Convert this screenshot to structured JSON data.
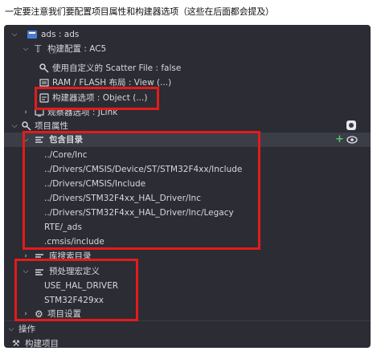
{
  "note": "一定要注意我们要配置项目属性和构建器选项（这些在后面都会提及）",
  "tree": {
    "root_label": "ads : ads",
    "build_config_label": "构建配置 : AC5",
    "clipped_row": "...",
    "scatter_label": "使用自定义的 Scatter File : false",
    "ramflash_label": "RAM / FLASH 布局 : View (...)",
    "builder_options_label": "构建器选项 : Object (...)",
    "observe_label": "观察器选项 : JLink",
    "project_props_label": "项目属性",
    "include_dirs_label": "包含目录",
    "include_dirs": [
      "../Core/Inc",
      "../Drivers/CMSIS/Device/ST/STM32F4xx/Include",
      "../Drivers/CMSIS/Include",
      "../Drivers/STM32F4xx_HAL_Driver/Inc",
      "../Drivers/STM32F4xx_HAL_Driver/Inc/Legacy",
      "RTE/_ads",
      ".cmsis/include"
    ],
    "lib_dirs_label": "库搜索目录",
    "defines_label": "预处理宏定义",
    "defines": [
      "USE_HAL_DRIVER",
      "STM32F429xx"
    ],
    "project_settings_label": "项目设置"
  },
  "actions": {
    "section_label": "操作",
    "build_label": "构建项目"
  },
  "colors": {
    "highlight": "#e41b1b",
    "panel_bg": "#2b2c34"
  }
}
